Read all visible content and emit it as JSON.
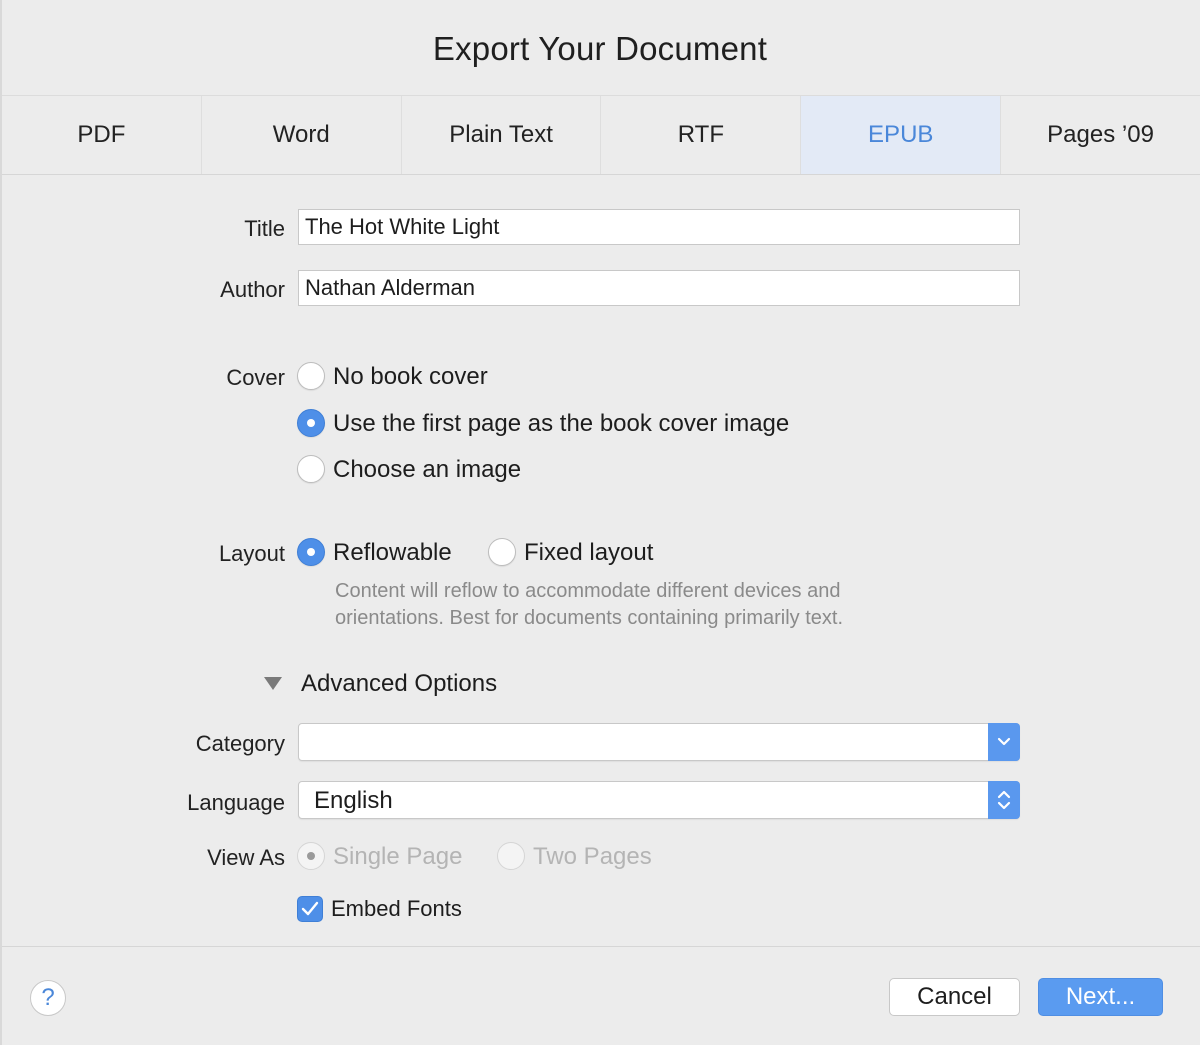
{
  "dialog": {
    "title": "Export Your Document"
  },
  "tabs": [
    {
      "label": "PDF",
      "active": false
    },
    {
      "label": "Word",
      "active": false
    },
    {
      "label": "Plain Text",
      "active": false
    },
    {
      "label": "RTF",
      "active": false
    },
    {
      "label": "EPUB",
      "active": true
    },
    {
      "label": "Pages ’09",
      "active": false
    }
  ],
  "form": {
    "title_label": "Title",
    "title_value": "The Hot White Light",
    "author_label": "Author",
    "author_value": "Nathan Alderman",
    "cover_label": "Cover",
    "cover_options": [
      {
        "label": "No book cover",
        "selected": false
      },
      {
        "label": "Use the first page as the book cover image",
        "selected": true
      },
      {
        "label": "Choose an image",
        "selected": false
      }
    ],
    "layout_label": "Layout",
    "layout_options": [
      {
        "label": "Reflowable",
        "selected": true
      },
      {
        "label": "Fixed layout",
        "selected": false
      }
    ],
    "layout_hint_line1": "Content will reflow to accommodate different devices and",
    "layout_hint_line2": "orientations. Best for documents containing primarily text.",
    "advanced_label": "Advanced Options",
    "category_label": "Category",
    "category_value": "",
    "language_label": "Language",
    "language_value": "English",
    "view_as_label": "View As",
    "view_as_options": [
      {
        "label": "Single Page",
        "selected": true,
        "disabled": true
      },
      {
        "label": "Two Pages",
        "selected": false,
        "disabled": true
      }
    ],
    "embed_fonts_label": "Embed Fonts",
    "embed_fonts_checked": true
  },
  "footer": {
    "help_label": "?",
    "cancel_label": "Cancel",
    "next_label": "Next..."
  },
  "colors": {
    "accent": "#4e8fe8",
    "active_tab_bg": "#e3eaf6",
    "active_tab_text": "#4a87d9",
    "dialog_bg": "#ececec"
  }
}
